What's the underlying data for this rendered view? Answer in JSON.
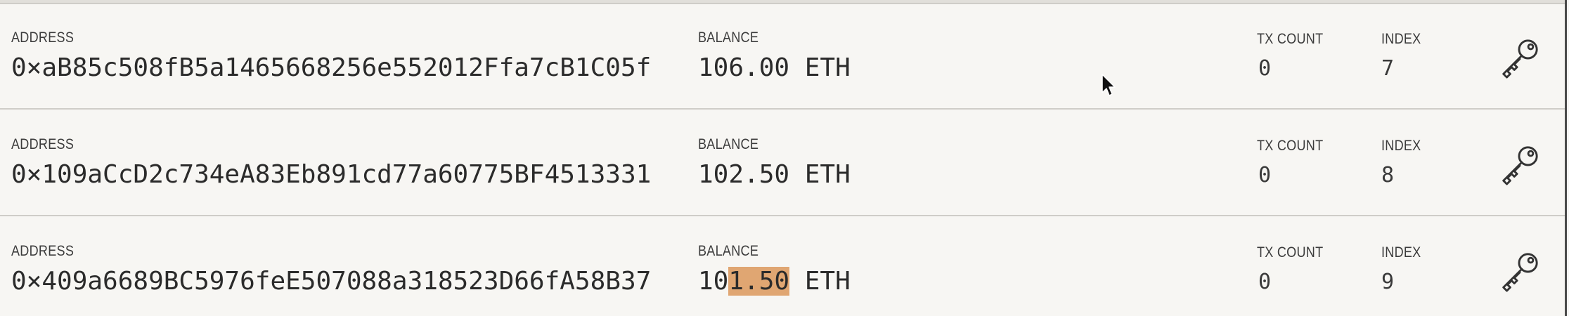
{
  "accounts": [
    {
      "address_label": "ADDRESS",
      "address": "0×aB85c508fB5a1465668256e552012Ffa7cB1C05f",
      "balance_label": "BALANCE",
      "balance": "106.00 ETH",
      "tx_count_label": "TX COUNT",
      "tx_count": "0",
      "index_label": "INDEX",
      "index": "7"
    },
    {
      "address_label": "ADDRESS",
      "address": "0×109aCcD2c734eA83Eb891cd77a60775BF4513331",
      "balance_label": "BALANCE",
      "balance": "102.50 ETH",
      "tx_count_label": "TX COUNT",
      "tx_count": "0",
      "index_label": "INDEX",
      "index": "8"
    },
    {
      "address_label": "ADDRESS",
      "address": "0×409a6689BC5976feE507088a318523D66fA58B37",
      "balance_label": "BALANCE",
      "balance_prefix": "10",
      "balance_highlight": "1.50",
      "balance_suffix": " ETH",
      "tx_count_label": "TX COUNT",
      "tx_count": "0",
      "index_label": "INDEX",
      "index": "9"
    }
  ],
  "icons": {
    "key": "key-icon",
    "cursor": "mouse-pointer-icon"
  },
  "colors": {
    "background": "#f7f6f3",
    "divider": "#cfcdc8",
    "text": "#2b2b2b",
    "selection_highlight": "#e0a672"
  }
}
